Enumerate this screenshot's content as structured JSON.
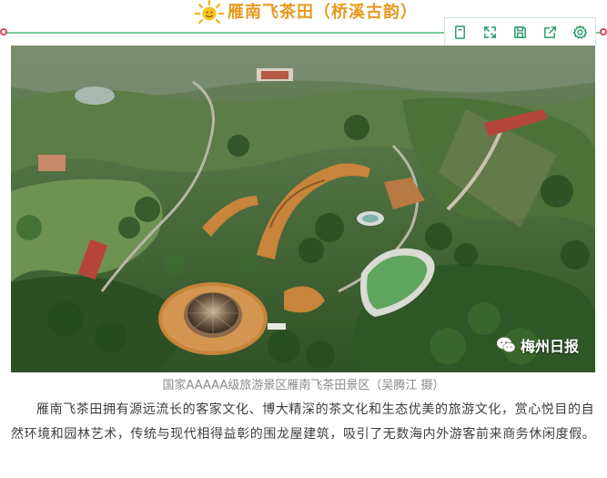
{
  "header": {
    "icon": "sun-icon",
    "title": "雁南飞茶田（桥溪古韵）",
    "accent_color": "#e79a1e",
    "rule_color": "#7ec89b"
  },
  "toolbar": {
    "buttons": [
      {
        "name": "bookmark-button",
        "icon": "bookmark-icon"
      },
      {
        "name": "fullscreen-button",
        "icon": "expand-icon"
      },
      {
        "name": "save-button",
        "icon": "save-icon"
      },
      {
        "name": "share-button",
        "icon": "share-icon"
      },
      {
        "name": "settings-button",
        "icon": "gear-icon"
      }
    ]
  },
  "photo": {
    "watermark": "梅州日报",
    "watermark_icon": "wechat-icon"
  },
  "caption": "国家AAAAA级旅游景区雁南飞茶田景区（吴腾江  摄）",
  "article": {
    "paragraph": "雁南飞茶田拥有源远流长的客家文化、博大精深的茶文化和生态优美的旅游文化，赏心悦目的自然环境和园林艺术，传统与现代相得益彰的围龙屋建筑，吸引了无数海内外游客前来商务休闲度假。"
  }
}
